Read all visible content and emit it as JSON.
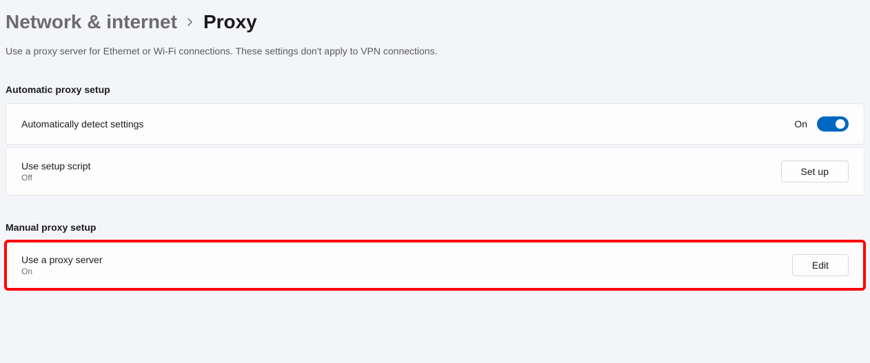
{
  "breadcrumb": {
    "parent": "Network & internet",
    "current": "Proxy"
  },
  "subtitle": "Use a proxy server for Ethernet or Wi-Fi connections. These settings don't apply to VPN connections.",
  "sections": {
    "automatic": {
      "header": "Automatic proxy setup",
      "items": [
        {
          "title": "Automatically detect settings",
          "toggle_state_label": "On"
        },
        {
          "title": "Use setup script",
          "status": "Off",
          "button_label": "Set up"
        }
      ]
    },
    "manual": {
      "header": "Manual proxy setup",
      "items": [
        {
          "title": "Use a proxy server",
          "status": "On",
          "button_label": "Edit"
        }
      ]
    }
  }
}
